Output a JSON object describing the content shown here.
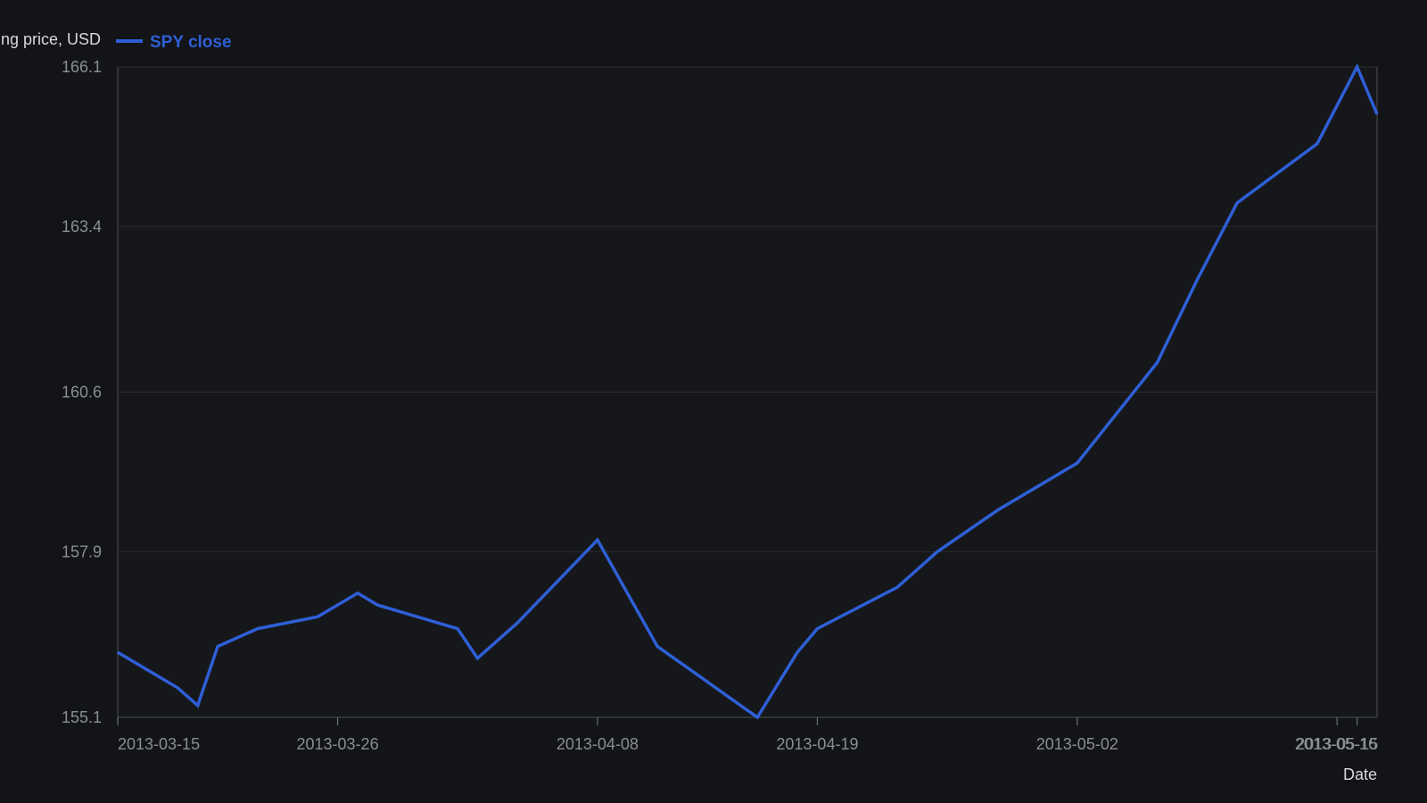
{
  "colors": {
    "background": "#131417",
    "plot_background": "#16171b",
    "series": "#2e5fd6",
    "tick_label": "#8a8d94",
    "axis_title": "#d7d9dd",
    "grid": "#2a2c31"
  },
  "chart_data": {
    "type": "line",
    "title": "",
    "xlabel": "Date",
    "ylabel": "ng price, USD",
    "ylim": [
      155.1,
      166.1
    ],
    "xlim": [
      "2013-03-15",
      "2013-05-17"
    ],
    "yticks": [
      "155.1",
      "157.9",
      "160.6",
      "163.4",
      "166.1"
    ],
    "xticks": [
      "2013-03-15",
      "2013-03-26",
      "2013-04-08",
      "2013-04-19",
      "2013-05-02",
      "2013-05-15",
      "2013-05-16"
    ],
    "grid": true,
    "legend": {
      "placement": "top-left",
      "entries": [
        "SPY close"
      ]
    },
    "series": [
      {
        "name": "SPY close",
        "color": "#2e5fd6",
        "x": [
          "2013-03-15",
          "2013-03-18",
          "2013-03-19",
          "2013-03-20",
          "2013-03-22",
          "2013-03-25",
          "2013-03-27",
          "2013-03-28",
          "2013-04-01",
          "2013-04-02",
          "2013-04-04",
          "2013-04-08",
          "2013-04-11",
          "2013-04-16",
          "2013-04-18",
          "2013-04-19",
          "2013-04-23",
          "2013-04-25",
          "2013-04-28",
          "2013-05-02",
          "2013-05-06",
          "2013-05-08",
          "2013-05-10",
          "2013-05-14",
          "2013-05-16",
          "2013-05-17"
        ],
        "values": [
          156.2,
          155.6,
          155.3,
          156.3,
          156.6,
          156.8,
          157.2,
          157.0,
          156.6,
          156.1,
          156.7,
          158.1,
          156.3,
          155.1,
          156.2,
          156.6,
          157.3,
          157.9,
          158.6,
          159.4,
          161.1,
          162.5,
          163.8,
          164.8,
          166.1,
          165.3
        ]
      }
    ]
  }
}
